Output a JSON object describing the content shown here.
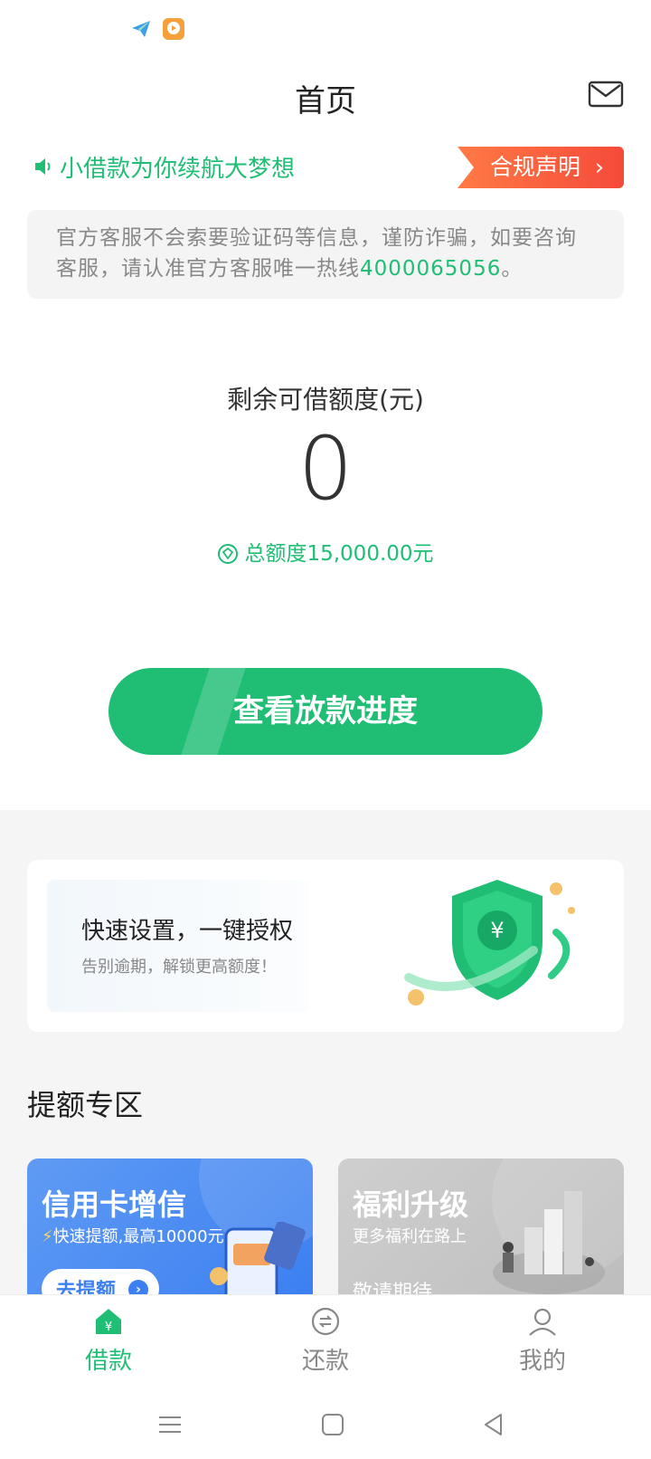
{
  "status_bar": {
    "icons": [
      "send-app-icon",
      "video-app-icon"
    ]
  },
  "header": {
    "title": "首页",
    "mail_icon": "mail-icon"
  },
  "notice": {
    "slogan": "小借款为你续航大梦想",
    "compliance_label": "合规声明",
    "compliance_arrow": "›"
  },
  "warning": {
    "text": "官方客服不会索要验证码等信息，谨防诈骗，如要咨询客服，请认准官方客服唯一热线",
    "phone": "4000065056",
    "suffix": "。"
  },
  "quota": {
    "label": "剩余可借额度(元)",
    "value": "0",
    "total": "总额度15,000.00元"
  },
  "main_button": {
    "label": "查看放款进度"
  },
  "auth_card": {
    "title": "快速设置，一键授权",
    "subtitle": "告别逾期，解锁更高额度！"
  },
  "section": {
    "title": "提额专区"
  },
  "promos": {
    "credit": {
      "title": "信用卡增信",
      "subtitle": "快速提额,最高10000元",
      "action": "去提额"
    },
    "welfare": {
      "title": "福利升级",
      "subtitle": "更多福利在路上",
      "pending": "敬请期待"
    }
  },
  "tabs": {
    "loan": "借款",
    "repay": "还款",
    "mine": "我的"
  },
  "colors": {
    "accent": "#1fbe74",
    "warning": "#f54a3a",
    "blue": "#3b7ff1"
  }
}
